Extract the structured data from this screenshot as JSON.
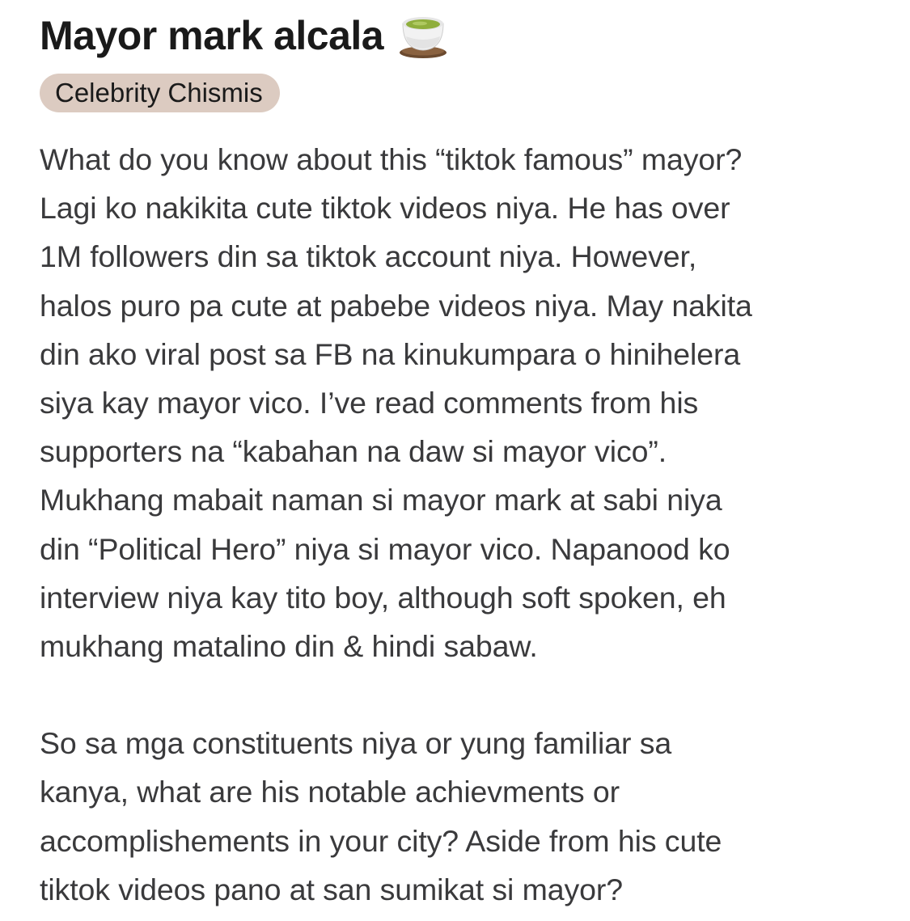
{
  "post": {
    "title": "Mayor mark alcala",
    "title_icon": "tea-cup-icon",
    "flair": "Celebrity Chismis",
    "flair_color": "#dccbc1",
    "paragraphs": [
      {
        "lines": [
          "What do you know about this “tiktok famous” mayor?",
          "Lagi ko nakikita cute tiktok videos niya. He has over",
          "1M followers din sa tiktok account niya. However,",
          "halos puro pa cute at pabebe videos niya. May nakita",
          "din ako viral post sa FB na kinukumpara o hinihelera",
          "siya kay mayor vico. I’ve read comments from his",
          "supporters na “kabahan na daw si mayor vico”.",
          "Mukhang mabait naman si mayor mark at sabi niya",
          "din “Political Hero” niya si mayor vico. Napanood ko",
          "interview niya kay tito boy, although soft spoken, eh",
          "mukhang matalino din & hindi sabaw."
        ]
      },
      {
        "lines": [
          "So sa mga constituents niya or yung familiar sa",
          "kanya, what are his notable achievments or",
          "accomplishements in your city? Aside from his cute",
          "tiktok videos pano at san sumikat si mayor?"
        ]
      }
    ]
  }
}
